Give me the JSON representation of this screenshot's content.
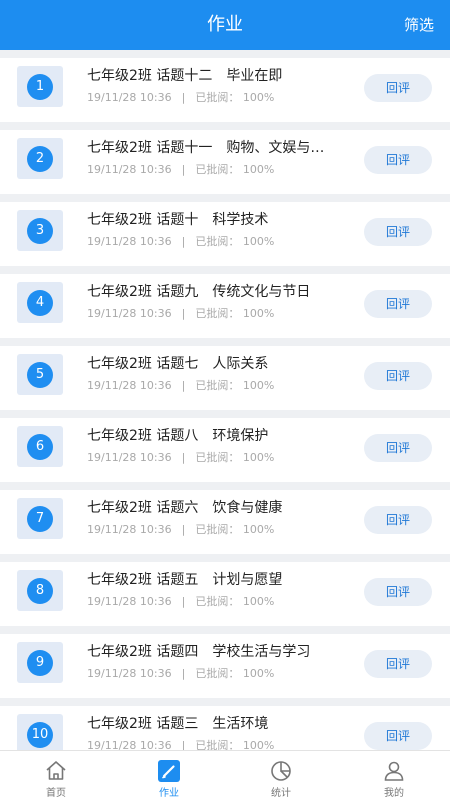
{
  "header": {
    "title": "作业",
    "filter_label": "筛选"
  },
  "list": {
    "items": [
      {
        "num": "1",
        "title": "七年级2班 话题十二　毕业在即",
        "date": "19/11/28 10:36",
        "sep": "|",
        "reviewed": "已批阅： 100%",
        "button": "回评"
      },
      {
        "num": "2",
        "title": "七年级2班 话题十一　购物、文娱与…",
        "date": "19/11/28 10:36",
        "sep": "|",
        "reviewed": "已批阅： 100%",
        "button": "回评"
      },
      {
        "num": "3",
        "title": "七年级2班 话题十　科学技术",
        "date": "19/11/28 10:36",
        "sep": "|",
        "reviewed": "已批阅： 100%",
        "button": "回评"
      },
      {
        "num": "4",
        "title": "七年级2班 话题九　传统文化与节日",
        "date": "19/11/28 10:36",
        "sep": "|",
        "reviewed": "已批阅： 100%",
        "button": "回评"
      },
      {
        "num": "5",
        "title": "七年级2班 话题七　人际关系",
        "date": "19/11/28 10:36",
        "sep": "|",
        "reviewed": "已批阅： 100%",
        "button": "回评"
      },
      {
        "num": "6",
        "title": "七年级2班 话题八　环境保护",
        "date": "19/11/28 10:36",
        "sep": "|",
        "reviewed": "已批阅： 100%",
        "button": "回评"
      },
      {
        "num": "7",
        "title": "七年级2班 话题六　饮食与健康",
        "date": "19/11/28 10:36",
        "sep": "|",
        "reviewed": "已批阅： 100%",
        "button": "回评"
      },
      {
        "num": "8",
        "title": "七年级2班 话题五　计划与愿望",
        "date": "19/11/28 10:36",
        "sep": "|",
        "reviewed": "已批阅： 100%",
        "button": "回评"
      },
      {
        "num": "9",
        "title": "七年级2班 话题四　学校生活与学习",
        "date": "19/11/28 10:36",
        "sep": "|",
        "reviewed": "已批阅： 100%",
        "button": "回评"
      },
      {
        "num": "10",
        "title": "七年级2班 话题三　生活环境",
        "date": "19/11/28 10:36",
        "sep": "|",
        "reviewed": "已批阅： 100%",
        "button": "回评"
      }
    ]
  },
  "tabbar": {
    "tabs": [
      {
        "label": "首页",
        "icon": "home-icon"
      },
      {
        "label": "作业",
        "icon": "homework-icon"
      },
      {
        "label": "统计",
        "icon": "pie-chart-icon"
      },
      {
        "label": "我的",
        "icon": "user-icon"
      }
    ],
    "active_index": 1
  },
  "colors": {
    "primary": "#1d8df0",
    "button_bg": "#e8eef6",
    "button_text": "#1f78d6"
  }
}
